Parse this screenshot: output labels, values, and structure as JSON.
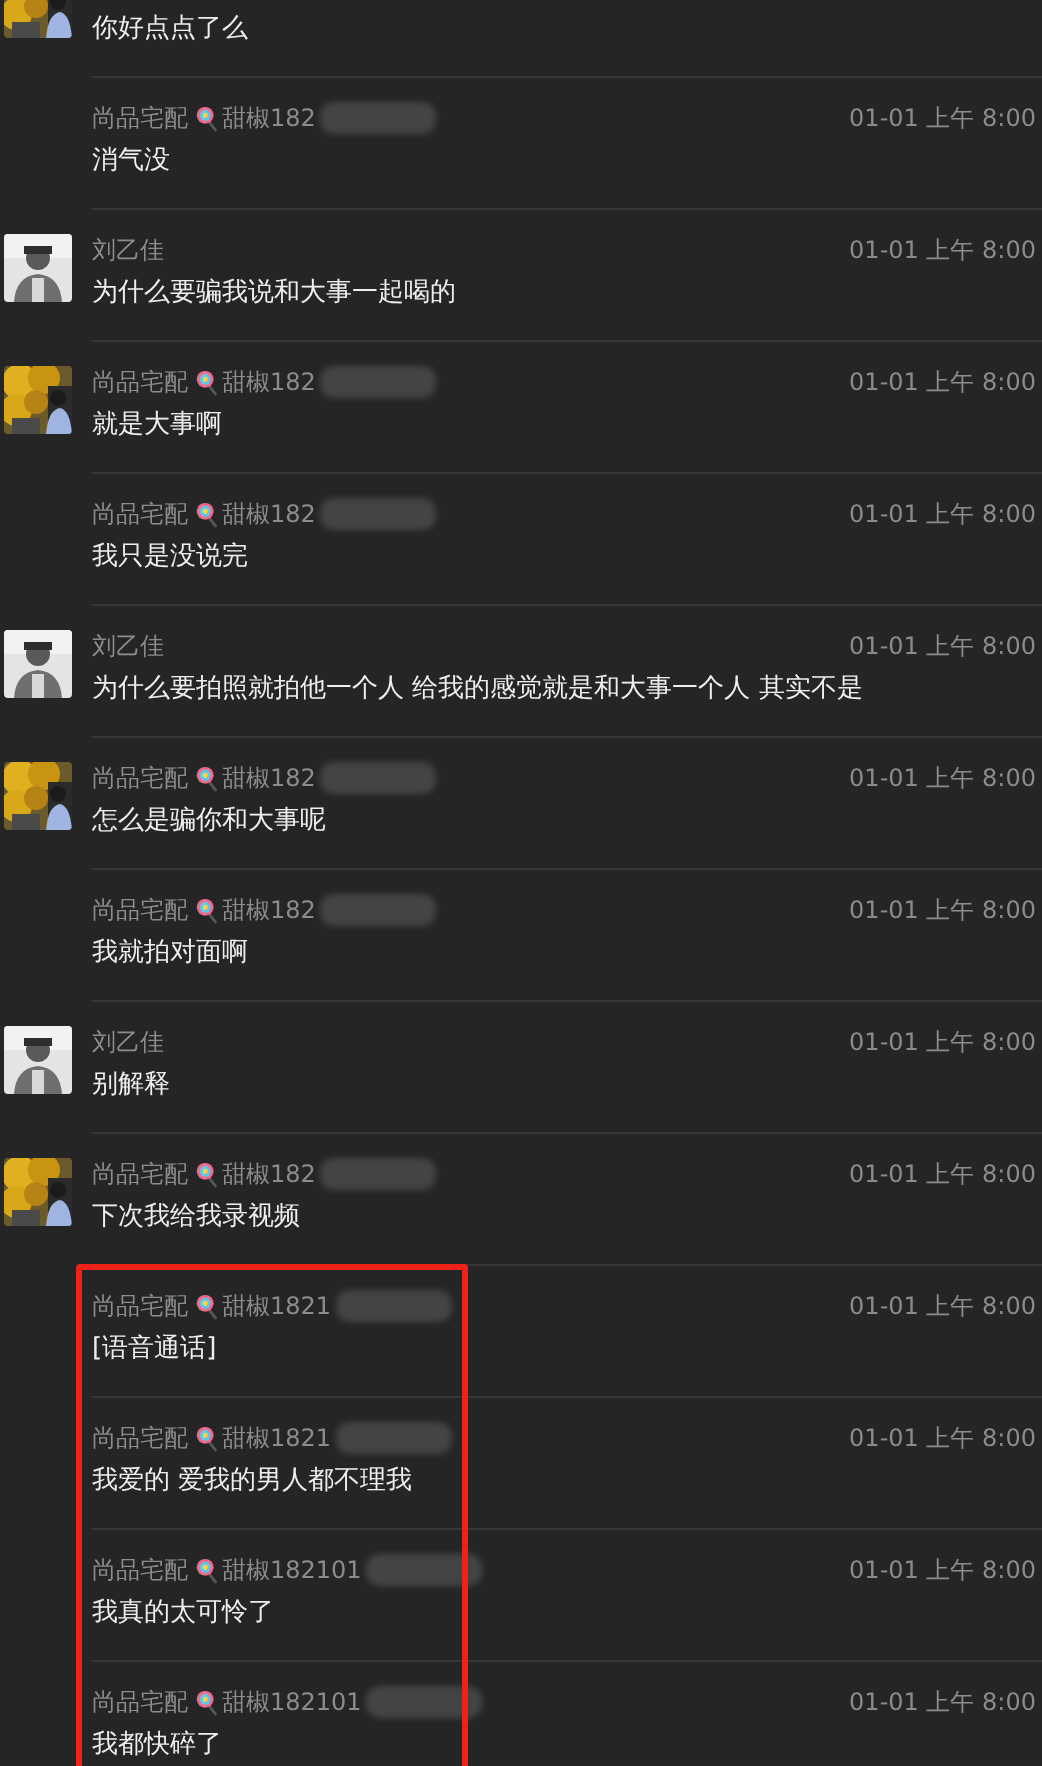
{
  "messages": [
    {
      "avatar": {
        "kind": "autumn"
      },
      "text": "你好点点了么"
    },
    {
      "sender": "尚品宅配",
      "handle": "甜椒182",
      "redacted": true,
      "time": "01-01 上午 8:00",
      "text": "消气没"
    },
    {
      "avatar": {
        "kind": "portrait"
      },
      "sender": "刘乙佳",
      "time": "01-01 上午 8:00",
      "text": "为什么要骗我说和大事一起喝的"
    },
    {
      "avatar": {
        "kind": "autumn"
      },
      "sender": "尚品宅配",
      "handle": "甜椒182",
      "redacted": true,
      "time": "01-01 上午 8:00",
      "text": "就是大事啊"
    },
    {
      "sender": "尚品宅配",
      "handle": "甜椒182",
      "redacted": true,
      "time": "01-01 上午 8:00",
      "text": "我只是没说完"
    },
    {
      "avatar": {
        "kind": "portrait"
      },
      "sender": "刘乙佳",
      "time": "01-01 上午 8:00",
      "text": "为什么要拍照就拍他一个人 给我的感觉就是和大事一个人 其实不是"
    },
    {
      "avatar": {
        "kind": "autumn"
      },
      "sender": "尚品宅配",
      "handle": "甜椒182",
      "redacted": true,
      "time": "01-01 上午 8:00",
      "text": "怎么是骗你和大事呢"
    },
    {
      "sender": "尚品宅配",
      "handle": "甜椒182",
      "redacted": true,
      "time": "01-01 上午 8:00",
      "text": "我就拍对面啊"
    },
    {
      "avatar": {
        "kind": "portrait"
      },
      "sender": "刘乙佳",
      "time": "01-01 上午 8:00",
      "text": "别解释"
    },
    {
      "avatar": {
        "kind": "autumn"
      },
      "sender": "尚品宅配",
      "handle": "甜椒182",
      "redacted": true,
      "time": "01-01 上午 8:00",
      "text": "下次我给我录视频"
    }
  ],
  "highlight_box": {
    "messages": [
      {
        "sender": "尚品宅配",
        "handle": "甜椒1821",
        "redacted": true,
        "time": "01-01 上午 8:00",
        "text": "[语音通话]"
      },
      {
        "sender": "尚品宅配",
        "handle": "甜椒1821",
        "redacted": true,
        "time": "01-01 上午 8:00",
        "text": "我爱的 爱我的男人都不理我"
      },
      {
        "sender": "尚品宅配",
        "handle": "甜椒182101",
        "redacted": true,
        "time": "01-01 上午 8:00",
        "text": "我真的太可怜了"
      },
      {
        "sender": "尚品宅配",
        "handle": "甜椒182101",
        "redacted": true,
        "time": "01-01 上午 8:00",
        "text": "我都快碎了"
      }
    ]
  }
}
